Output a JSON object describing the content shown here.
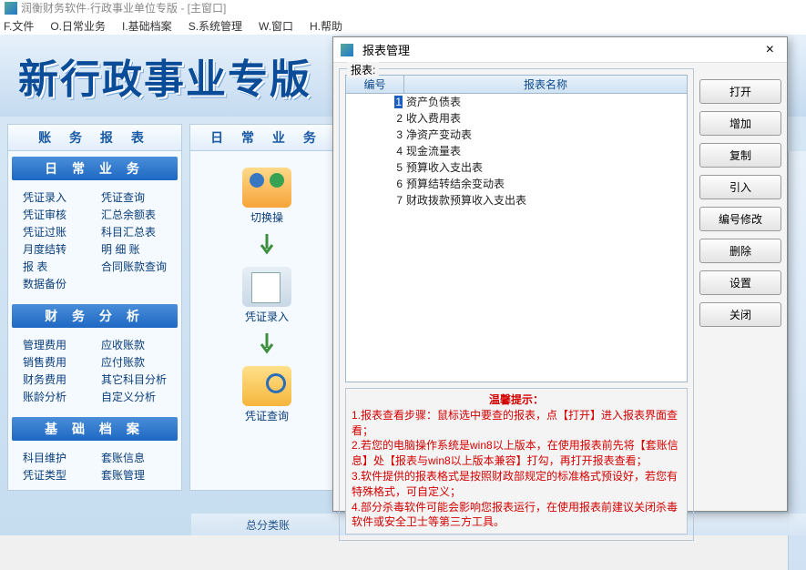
{
  "app": {
    "window_title": "润衡财务软件·行政事业单位专版 - [主窗口]",
    "banner_title": "新行政事业专版"
  },
  "menubar": [
    "F.文件",
    "O.日常业务",
    "I.基础档案",
    "S.系统管理",
    "W.窗口",
    "H.帮助"
  ],
  "sidebar": {
    "title": "账 务 报 表",
    "sections": [
      {
        "header": "日 常 业 务",
        "links": [
          "凭证录入",
          "凭证查询",
          "凭证审核",
          "汇总余额表",
          "凭证过账",
          "科目汇总表",
          "月度结转",
          "明 细 账",
          "报  表",
          "合同账款查询",
          "数据备份",
          ""
        ]
      },
      {
        "header": "财 务 分 析",
        "links": [
          "管理费用",
          "应收账款",
          "销售费用",
          "应付账款",
          "财务费用",
          "其它科目分析",
          "账龄分析",
          "自定义分析"
        ]
      },
      {
        "header": "基 础 档 案",
        "links": [
          "科目维护",
          "套账信息",
          "凭证类型",
          "套账管理"
        ]
      }
    ]
  },
  "center": {
    "title": "日 常 业 务",
    "items": [
      "切换操",
      "凭证录入",
      "凭证查询"
    ]
  },
  "bottom_faded": [
    "总分类账",
    "",
    "",
    "",
    ""
  ],
  "dialog": {
    "title": "报表管理",
    "fieldset_label": "报表:",
    "columns": [
      "编号",
      "报表名称"
    ],
    "rows": [
      {
        "no": "1",
        "name": "资产负债表",
        "selected": true
      },
      {
        "no": "2",
        "name": "收入费用表"
      },
      {
        "no": "3",
        "name": "净资产变动表"
      },
      {
        "no": "4",
        "name": "现金流量表"
      },
      {
        "no": "5",
        "name": "预算收入支出表"
      },
      {
        "no": "6",
        "name": "预算结转结余变动表"
      },
      {
        "no": "7",
        "name": "财政拨款预算收入支出表"
      }
    ],
    "buttons": [
      "打开",
      "增加",
      "复制",
      "引入",
      "编号修改",
      "删除",
      "设置",
      "关闭"
    ],
    "tips": {
      "title": "温馨提示：",
      "lines": [
        "1.报表查看步骤：鼠标选中要查的报表，点【打开】进入报表界面查看；",
        "2.若您的电脑操作系统是win8以上版本，在使用报表前先将【套账信息】处【报表与win8以上版本兼容】打勾，再打开报表查看；",
        "3.软件提供的报表格式是按照财政部规定的标准格式预设好，若您有特殊格式，可自定义；",
        "4.部分杀毒软件可能会影响您报表运行，在使用报表前建议关闭杀毒软件或安全卫士等第三方工具。"
      ]
    }
  }
}
